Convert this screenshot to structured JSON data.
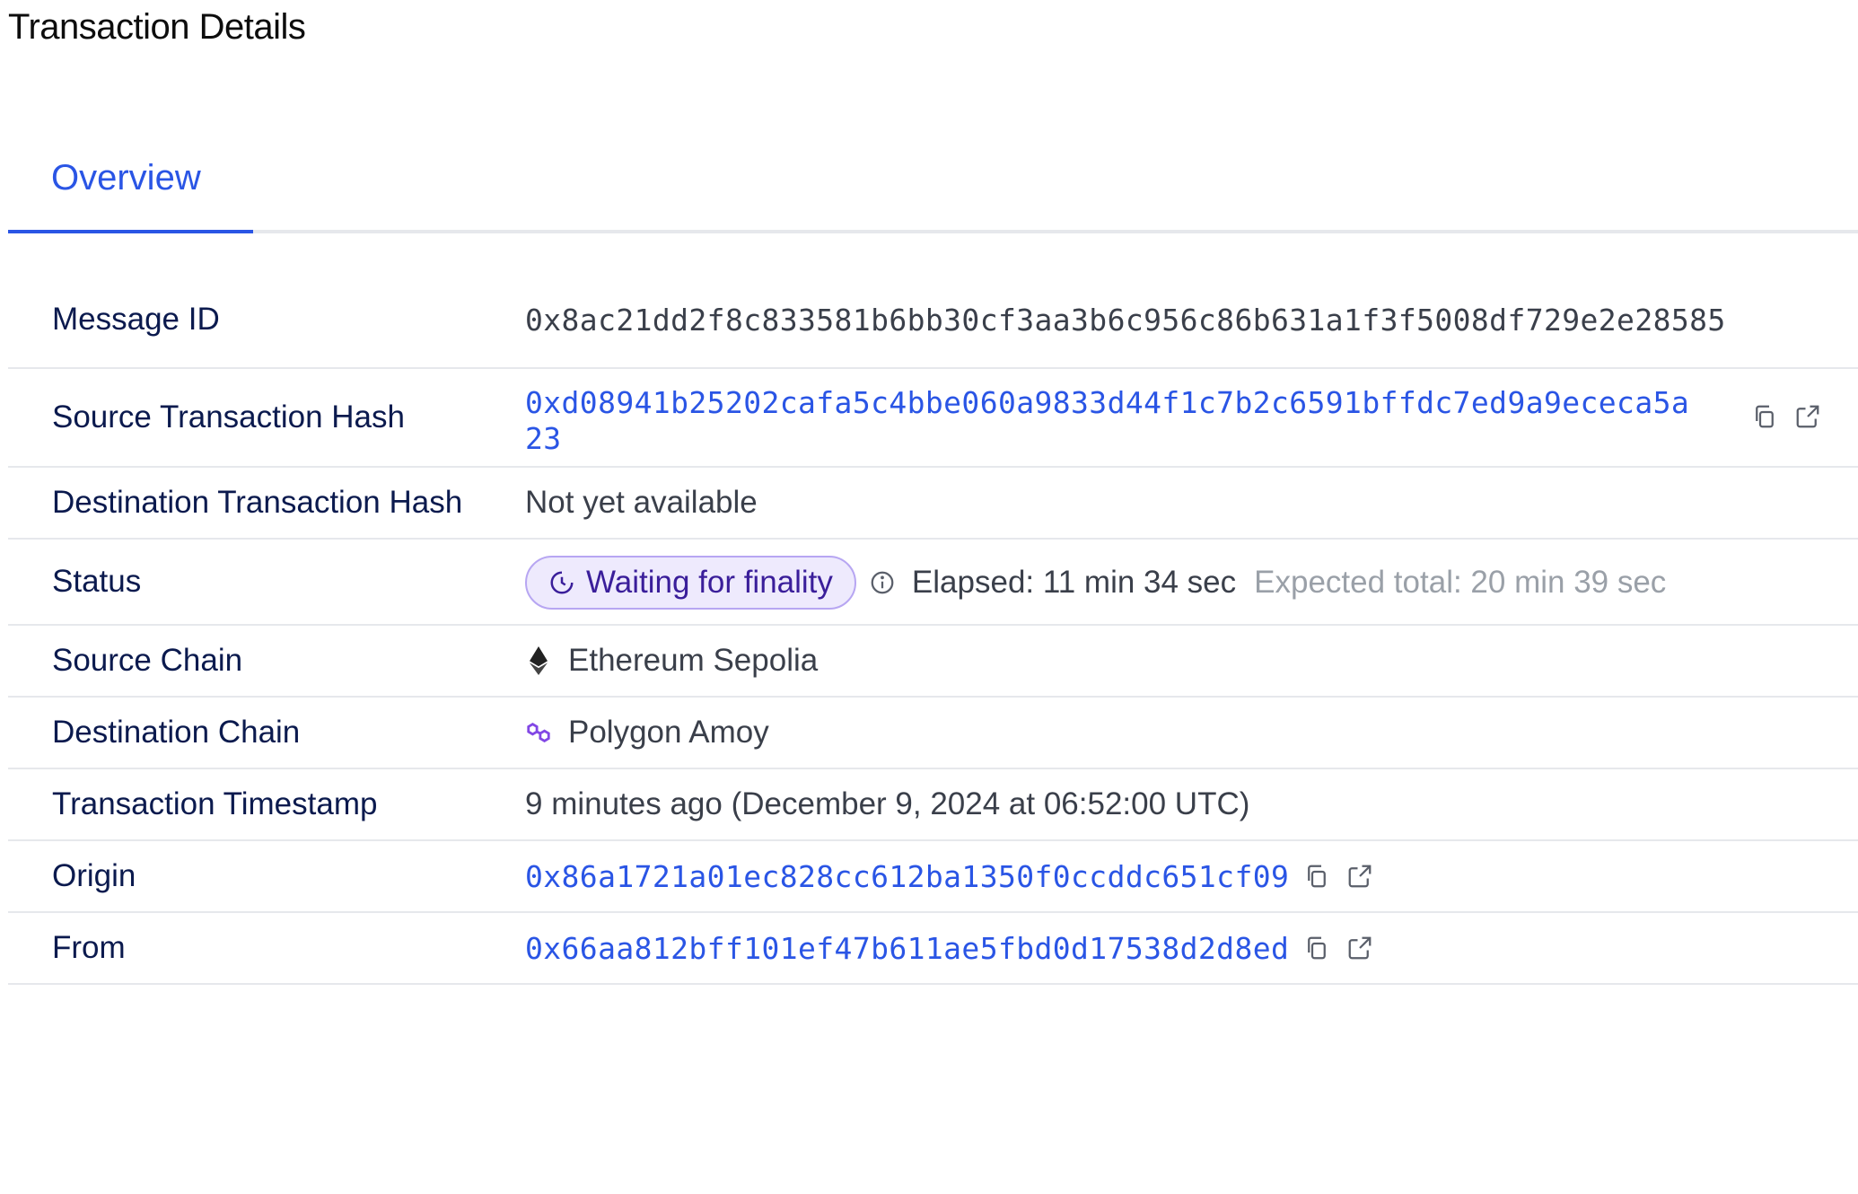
{
  "page": {
    "title": "Transaction Details"
  },
  "tabs": [
    {
      "label": "Overview",
      "active": true
    }
  ],
  "rows": {
    "message_id": {
      "label": "Message ID",
      "value": "0x8ac21dd2f8c833581b6bb30cf3aa3b6c956c86b631a1f3f5008df729e2e28585"
    },
    "source_tx_hash": {
      "label": "Source Transaction Hash",
      "value_line1": "0xd08941b25202cafa5c4bbe060a9833d44f1c7b2c6591bffdc7ed9a9ececa5a",
      "value_line2": "23"
    },
    "dest_tx_hash": {
      "label": "Destination Transaction Hash",
      "value": "Not yet available"
    },
    "status": {
      "label": "Status",
      "badge": "Waiting for finality",
      "elapsed": "Elapsed: 11 min 34 sec",
      "expected": "Expected total: 20 min 39 sec"
    },
    "source_chain": {
      "label": "Source Chain",
      "value": "Ethereum Sepolia",
      "icon": "ethereum-icon"
    },
    "dest_chain": {
      "label": "Destination Chain",
      "value": "Polygon Amoy",
      "icon": "polygon-icon"
    },
    "timestamp": {
      "label": "Transaction Timestamp",
      "value": "9 minutes ago (December 9, 2024 at 06:52:00 UTC)"
    },
    "origin": {
      "label": "Origin",
      "value": "0x86a1721a01ec828cc612ba1350f0ccddc651cf09"
    },
    "from": {
      "label": "From",
      "value": "0x66aa812bff101ef47b611ae5fbd0d17538d2d8ed"
    }
  },
  "colors": {
    "accent": "#2a55e5",
    "label": "#0b1a4e",
    "badge_bg": "#eeeafd",
    "badge_border": "#b7a6f2",
    "polygon": "#8247e5"
  }
}
